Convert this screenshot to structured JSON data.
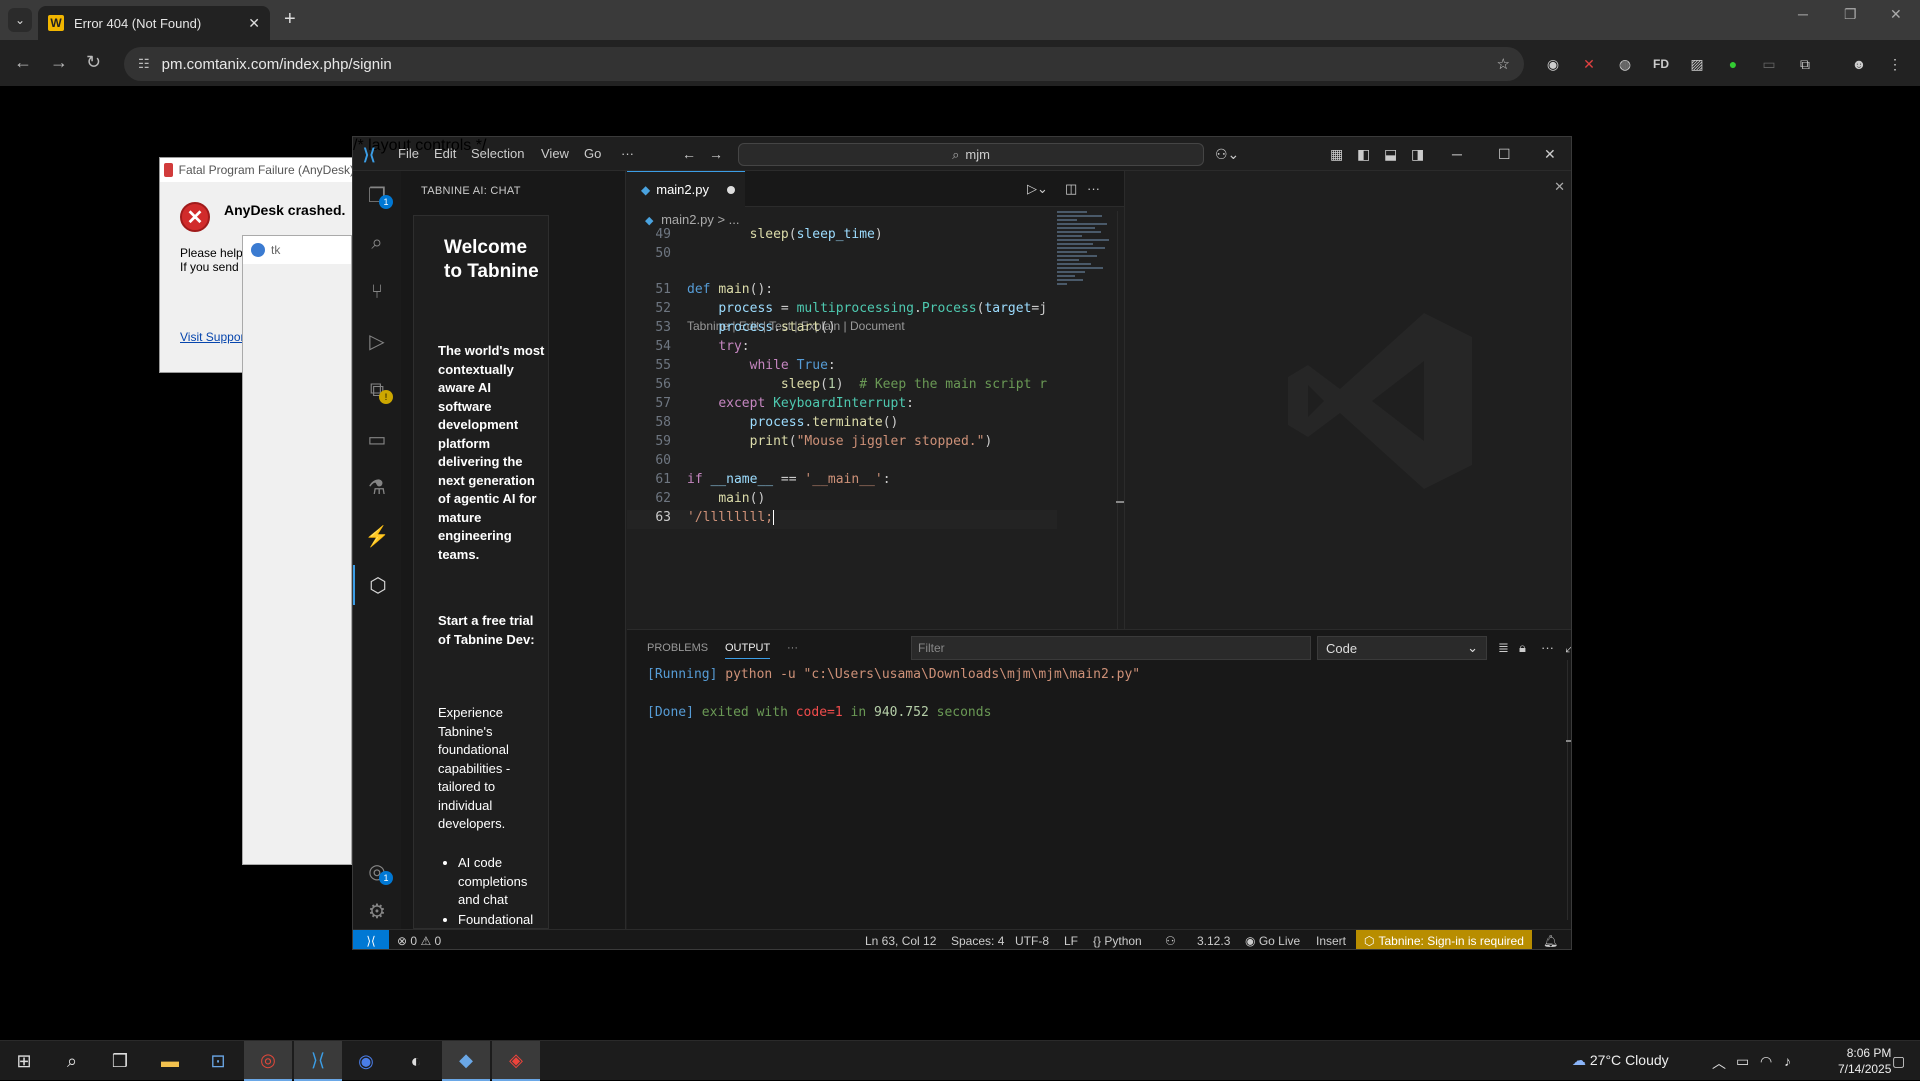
{
  "browser": {
    "tab_title": "Error 404 (Not Found)",
    "tab_favicon": "W",
    "url": "pm.comtanix.com/index.php/signin"
  },
  "anydesk_dialog": {
    "title": "Fatal Program Failure (AnyDesk)",
    "heading": "AnyDesk crashed.",
    "body_line1": "Please help",
    "body_line2": "If you send",
    "link": "Visit Suppor"
  },
  "tk_window": {
    "title": "tk"
  },
  "vscode": {
    "menu": [
      "File",
      "Edit",
      "Selection",
      "View",
      "Go",
      "···"
    ],
    "search": "mjm",
    "sidebar_title": "TABNINE AI: CHAT",
    "chat": {
      "welcome": "Welcome to Tabnine",
      "intro": "The world's most contextually aware AI software development platform delivering the next generation of agentic AI for mature engineering teams.",
      "trial": "Start a free trial of Tabnine Dev:",
      "experience": "Experience Tabnine's foundational capabilities - tailored to individual developers.",
      "bullets": [
        "AI code completions and chat",
        "Foundational"
      ]
    },
    "activity_badges": {
      "explorer": "1",
      "accounts": "1"
    },
    "file_tab": "main2.py",
    "breadcrumb_file": "main2.py",
    "breadcrumb_rest": "> ...",
    "codelens": "Tabnine | Edit | Test | Explain | Document",
    "line_numbers": [
      "49",
      "50",
      "51",
      "52",
      "53",
      "54",
      "55",
      "56",
      "57",
      "58",
      "59",
      "60",
      "61",
      "62",
      "63"
    ],
    "panel": {
      "tabs": [
        "PROBLEMS",
        "OUTPUT"
      ],
      "filter_placeholder": "Filter",
      "channel": "Code",
      "out_running_tag": "[Running]",
      "out_running_cmd": "python -u \"c:\\Users\\usama\\Downloads\\mjm\\mjm\\main2.py\"",
      "out_done_tag": "[Done]",
      "out_done_1": "exited with",
      "out_done_code": "code=1",
      "out_done_2": "in",
      "out_done_secs": "940.752",
      "out_done_3": "seconds"
    },
    "status": {
      "errors": "0",
      "warnings": "0",
      "position": "Ln 63, Col 12",
      "spaces": "Spaces: 4",
      "encoding": "UTF-8",
      "eol": "LF",
      "language": "Python",
      "python_version": "3.12.3",
      "go_live": "Go Live",
      "mode": "Insert",
      "tabnine": "Tabnine: Sign-in is required"
    }
  },
  "taskbar": {
    "temperature": "27°C",
    "weather": "Cloudy",
    "time": "8:06 PM",
    "date": "7/14/2025"
  },
  "colors": {
    "accent": "#3c9ee6",
    "tabnine_warning": "#b88d00",
    "remote": "#0078d4"
  }
}
